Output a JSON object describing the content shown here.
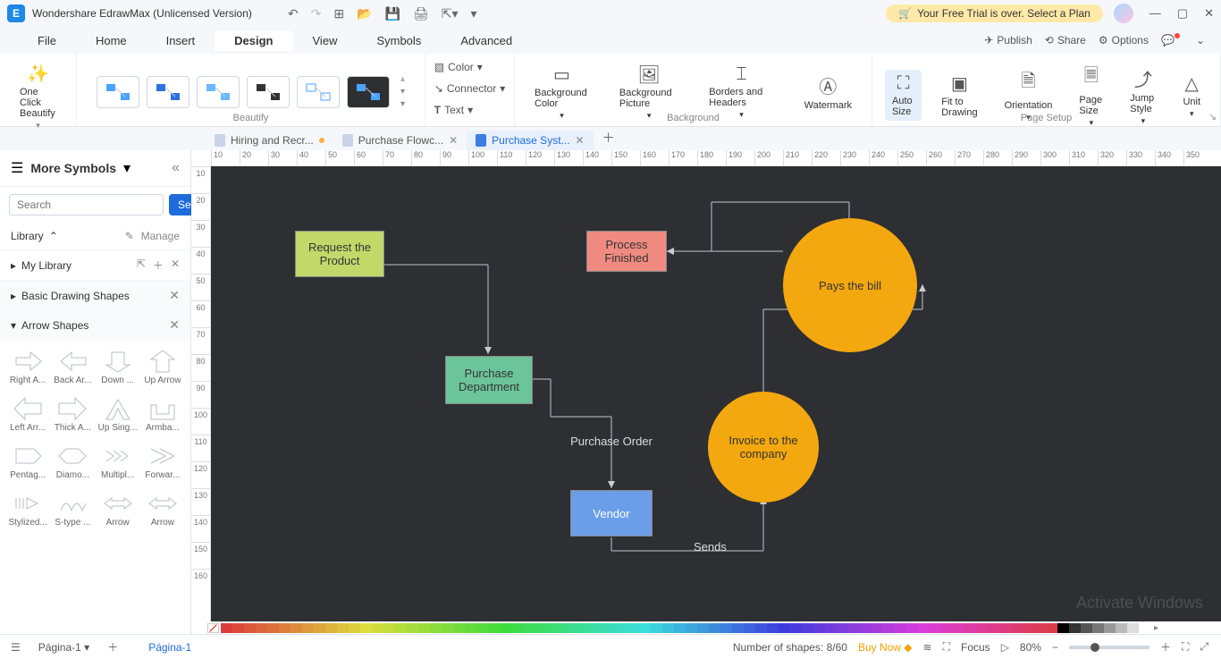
{
  "app": {
    "title": "Wondershare EdrawMax (Unlicensed Version)",
    "trial_banner": "Your Free Trial is over. Select a Plan"
  },
  "menu": {
    "items": [
      "File",
      "Home",
      "Insert",
      "Design",
      "View",
      "Symbols",
      "Advanced"
    ],
    "active": "Design",
    "publish": "Publish",
    "share": "Share",
    "options": "Options"
  },
  "ribbon": {
    "beautify_btn": "One Click Beautify",
    "beautify_group": "Beautify",
    "color": "Color",
    "connector": "Connector",
    "text": "Text",
    "bg_color": "Background Color",
    "bg_picture": "Background Picture",
    "borders": "Borders and Headers",
    "watermark": "Watermark",
    "bg_group": "Background",
    "auto_size": "Auto Size",
    "fit_drawing": "Fit to Drawing",
    "orientation": "Orientation",
    "page_size": "Page Size",
    "jump_style": "Jump Style",
    "unit": "Unit",
    "page_group": "Page Setup"
  },
  "tabs": [
    {
      "label": "Hiring and Recr...",
      "modified": true,
      "active": false
    },
    {
      "label": "Purchase Flowc...",
      "modified": false,
      "active": false
    },
    {
      "label": "Purchase Syst...",
      "modified": false,
      "active": true
    }
  ],
  "sidebar": {
    "header": "More Symbols",
    "search_placeholder": "Search",
    "search_btn": "Search",
    "library": "Library",
    "manage": "Manage",
    "my_library": "My Library",
    "basic_shapes": "Basic Drawing Shapes",
    "arrow_shapes": "Arrow Shapes",
    "arrows": [
      "Right A...",
      "Back Ar...",
      "Down ...",
      "Up Arrow",
      "Left Arr...",
      "Thick A...",
      "Up Sing...",
      "Armba...",
      "Pentag...",
      "Diamo...",
      "Multipl...",
      "Forwar...",
      "Stylized...",
      "S-type ...",
      "Arrow",
      "Arrow"
    ]
  },
  "ruler_h": [
    "10",
    "20",
    "30",
    "40",
    "50",
    "60",
    "70",
    "80",
    "90",
    "100",
    "110",
    "120",
    "130",
    "140",
    "150",
    "160",
    "170",
    "180",
    "190",
    "200",
    "210",
    "220",
    "230",
    "240",
    "250",
    "260",
    "270",
    "280",
    "290",
    "300",
    "310",
    "320",
    "330",
    "340",
    "350"
  ],
  "ruler_v": [
    "10",
    "20",
    "30",
    "40",
    "50",
    "60",
    "70",
    "80",
    "90",
    "100",
    "110",
    "120",
    "130",
    "140",
    "150",
    "160"
  ],
  "diagram": {
    "request": "Request the Product",
    "process": "Process Finished",
    "pays": "Pays the bill",
    "purchase_dept": "Purchase Department",
    "purchase_order": "Purchase Order",
    "vendor": "Vendor",
    "invoice": "Invoice to the company",
    "sends": "Sends",
    "watermark": "Activate Windows"
  },
  "status": {
    "page_dropdown": "Página-1",
    "active_page": "Página-1",
    "shapes": "Number of shapes: 8/60",
    "buy": "Buy Now",
    "focus": "Focus",
    "zoom": "80%"
  }
}
